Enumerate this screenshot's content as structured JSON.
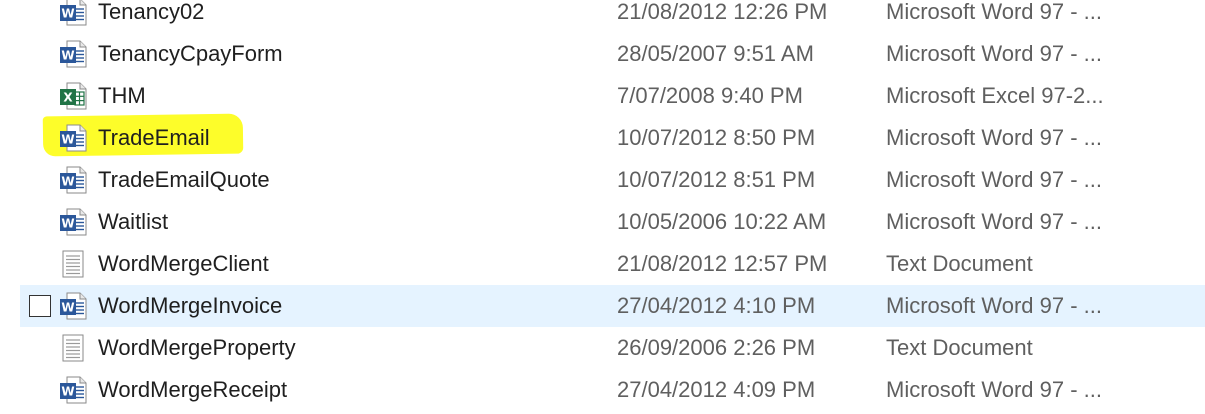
{
  "files": [
    {
      "name": "Tenancy02",
      "modified": "21/08/2012 12:26 PM",
      "type": "Microsoft Word 97 - ...",
      "icon": "word-doc-icon",
      "highlighted": false,
      "hover": false
    },
    {
      "name": "TenancyCpayForm",
      "modified": "28/05/2007 9:51 AM",
      "type": "Microsoft Word 97 - ...",
      "icon": "word-doc-icon",
      "highlighted": false,
      "hover": false
    },
    {
      "name": "THM",
      "modified": "7/07/2008 9:40 PM",
      "type": "Microsoft Excel 97-2...",
      "icon": "excel-doc-icon",
      "highlighted": false,
      "hover": false
    },
    {
      "name": "TradeEmail",
      "modified": "10/07/2012 8:50 PM",
      "type": "Microsoft Word 97 - ...",
      "icon": "word-doc-icon",
      "highlighted": true,
      "hover": false
    },
    {
      "name": "TradeEmailQuote",
      "modified": "10/07/2012 8:51 PM",
      "type": "Microsoft Word 97 - ...",
      "icon": "word-doc-icon",
      "highlighted": false,
      "hover": false
    },
    {
      "name": "Waitlist",
      "modified": "10/05/2006 10:22 AM",
      "type": "Microsoft Word 97 - ...",
      "icon": "word-doc-icon",
      "highlighted": false,
      "hover": false
    },
    {
      "name": "WordMergeClient",
      "modified": "21/08/2012 12:57 PM",
      "type": "Text Document",
      "icon": "text-doc-icon",
      "highlighted": false,
      "hover": false
    },
    {
      "name": "WordMergeInvoice",
      "modified": "27/04/2012 4:10 PM",
      "type": "Microsoft Word 97 - ...",
      "icon": "word-doc-icon",
      "highlighted": false,
      "hover": true
    },
    {
      "name": "WordMergeProperty",
      "modified": "26/09/2006 2:26 PM",
      "type": "Text Document",
      "icon": "text-doc-icon",
      "highlighted": false,
      "hover": false
    },
    {
      "name": "WordMergeReceipt",
      "modified": "27/04/2012 4:09 PM",
      "type": "Microsoft Word 97 - ...",
      "icon": "word-doc-icon",
      "highlighted": false,
      "hover": false
    }
  ],
  "colors": {
    "hover_row": "#e5f3ff",
    "highlighter": "#fdfd2a",
    "word_blue": "#2b579a",
    "excel_green": "#217346"
  }
}
